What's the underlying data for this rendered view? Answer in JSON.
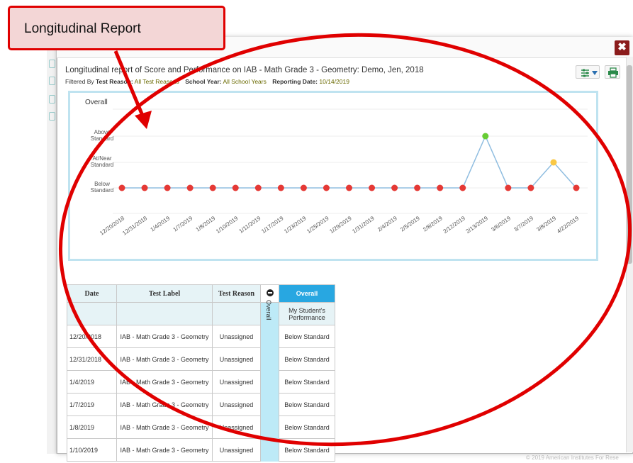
{
  "callout": {
    "label": "Longitudinal Report"
  },
  "report": {
    "title": "Longitudinal report of Score and Performance on IAB - Math Grade 3 - Geometry: Demo, Jen, 2018",
    "filtered_by_label": "Filtered By",
    "test_reason_label": "Test Reason:",
    "test_reason_value": "All Test Reasons",
    "school_year_label": "School Year:",
    "school_year_value": "All School Years",
    "reporting_date_label": "Reporting Date:",
    "reporting_date_value": "10/14/2019"
  },
  "icons": {
    "close": "close-icon",
    "settings": "settings-sliders-icon",
    "print": "print-icon"
  },
  "close_glyph": "✖",
  "chart_data": {
    "type": "line",
    "title": "Overall",
    "y_categories": [
      "Below Standard",
      "At/Near Standard",
      "Above Standard"
    ],
    "x": [
      "12/20/2018",
      "12/31/2018",
      "1/4/2019",
      "1/7/2019",
      "1/8/2019",
      "1/10/2019",
      "1/11/2019",
      "1/17/2019",
      "1/23/2019",
      "1/25/2019",
      "1/29/2019",
      "1/31/2019",
      "2/4/2019",
      "2/5/2019",
      "2/8/2019",
      "2/12/2019",
      "2/13/2019",
      "3/6/2019",
      "3/7/2019",
      "3/8/2019",
      "4/22/2019"
    ],
    "values": [
      "Below Standard",
      "Below Standard",
      "Below Standard",
      "Below Standard",
      "Below Standard",
      "Below Standard",
      "Below Standard",
      "Below Standard",
      "Below Standard",
      "Below Standard",
      "Below Standard",
      "Below Standard",
      "Below Standard",
      "Below Standard",
      "Below Standard",
      "Below Standard",
      "Above Standard",
      "Below Standard",
      "Below Standard",
      "At/Near Standard",
      "Below Standard"
    ],
    "colors": {
      "Below Standard": "#e53935",
      "At/Near Standard": "#f9c846",
      "Above Standard": "#66cc33",
      "line": "#8fbde0"
    }
  },
  "table": {
    "headers": {
      "date": "Date",
      "test_label": "Test Label",
      "test_reason": "Test Reason",
      "overall": "Overall"
    },
    "collapse_label": "Overall",
    "sub_header": "My Student's Performance",
    "rows": [
      {
        "date": "12/20/2018",
        "test_label": "IAB - Math Grade 3 - Geometry",
        "test_reason": "Unassigned",
        "overall": "Below Standard"
      },
      {
        "date": "12/31/2018",
        "test_label": "IAB - Math Grade 3 - Geometry",
        "test_reason": "Unassigned",
        "overall": "Below Standard"
      },
      {
        "date": "1/4/2019",
        "test_label": "IAB - Math Grade 3 - Geometry",
        "test_reason": "Unassigned",
        "overall": "Below Standard"
      },
      {
        "date": "1/7/2019",
        "test_label": "IAB - Math Grade 3 - Geometry",
        "test_reason": "Unassigned",
        "overall": "Below Standard"
      },
      {
        "date": "1/8/2019",
        "test_label": "IAB - Math Grade 3 - Geometry",
        "test_reason": "Unassigned",
        "overall": "Below Standard"
      },
      {
        "date": "1/10/2019",
        "test_label": "IAB - Math Grade 3 - Geometry",
        "test_reason": "Unassigned",
        "overall": "Below Standard"
      }
    ]
  },
  "footer": "© 2019 American Institutes For Rese"
}
